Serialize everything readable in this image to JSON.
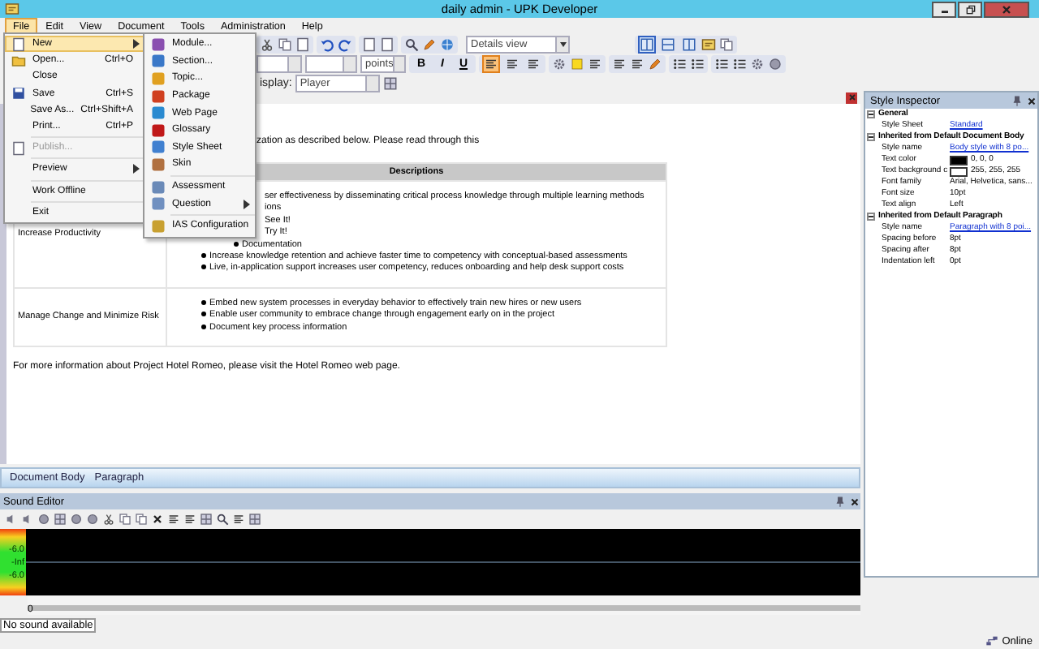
{
  "window": {
    "title": "daily admin - UPK Developer"
  },
  "menu_bar": [
    {
      "label": "File",
      "selected": true
    },
    {
      "label": "Edit",
      "selected": false
    },
    {
      "label": "View",
      "selected": false
    },
    {
      "label": "Document",
      "selected": false
    },
    {
      "label": "Tools",
      "selected": false
    },
    {
      "label": "Administration",
      "selected": false
    },
    {
      "label": "Help",
      "selected": false
    }
  ],
  "file_menu": [
    {
      "kind": "item",
      "label": "New",
      "submenu": true,
      "selected": true,
      "disabled": false
    },
    {
      "kind": "item",
      "label": "Open...",
      "shortcut": "Ctrl+O",
      "submenu": false,
      "selected": false,
      "disabled": false
    },
    {
      "kind": "item",
      "label": "Close",
      "submenu": false,
      "selected": false,
      "disabled": false
    },
    {
      "kind": "item",
      "label": "Save",
      "shortcut": "Ctrl+S",
      "submenu": false,
      "selected": false,
      "disabled": false
    },
    {
      "kind": "item",
      "label": "Save As...",
      "shortcut": "Ctrl+Shift+A",
      "submenu": false,
      "selected": false,
      "disabled": false
    },
    {
      "kind": "item",
      "label": "Print...",
      "shortcut": "Ctrl+P",
      "submenu": false,
      "selected": false,
      "disabled": false
    },
    {
      "kind": "separator"
    },
    {
      "kind": "item",
      "label": "Publish...",
      "submenu": false,
      "selected": false,
      "disabled": true
    },
    {
      "kind": "separator"
    },
    {
      "kind": "item",
      "label": "Preview",
      "submenu": true,
      "selected": false,
      "disabled": false
    },
    {
      "kind": "separator"
    },
    {
      "kind": "item",
      "label": "Work Offline",
      "submenu": false,
      "selected": false,
      "disabled": false
    },
    {
      "kind": "separator"
    },
    {
      "kind": "item",
      "label": "Exit",
      "submenu": false,
      "selected": false,
      "disabled": false
    }
  ],
  "new_submenu": [
    {
      "kind": "item",
      "label": "Module...",
      "submenu": false,
      "color": "#8a4fb0"
    },
    {
      "kind": "item",
      "label": "Section...",
      "submenu": false,
      "color": "#3a78c8"
    },
    {
      "kind": "item",
      "label": "Topic...",
      "submenu": false,
      "color": "#e0a020"
    },
    {
      "kind": "item",
      "label": "Package",
      "submenu": false,
      "color": "#d04020"
    },
    {
      "kind": "item",
      "label": "Web Page",
      "submenu": false,
      "color": "#2a8ad0"
    },
    {
      "kind": "item",
      "label": "Glossary",
      "submenu": false,
      "color": "#c01818"
    },
    {
      "kind": "item",
      "label": "Style Sheet",
      "submenu": false,
      "color": "#4080d0"
    },
    {
      "kind": "item",
      "label": "Skin",
      "submenu": false,
      "color": "#b07040"
    },
    {
      "kind": "separator"
    },
    {
      "kind": "item",
      "label": "Assessment",
      "submenu": false,
      "color": "#6a8ab8"
    },
    {
      "kind": "item",
      "label": "Question",
      "submenu": true,
      "color": "#7090c0"
    },
    {
      "kind": "separator"
    },
    {
      "kind": "item",
      "label": "IAS Configuration",
      "submenu": false,
      "color": "#c8a030"
    }
  ],
  "toolbar": {
    "view_select": "Details view",
    "layout_buttons": [
      {
        "selected": true
      },
      {
        "selected": false
      },
      {
        "selected": false
      }
    ],
    "size_select": "points",
    "format_buttons": [
      {
        "label": "B",
        "selected": false
      },
      {
        "label": "I",
        "selected": false
      },
      {
        "label": "U",
        "selected": false
      }
    ],
    "align_buttons": [
      {
        "selected": true
      },
      {
        "selected": false
      },
      {
        "selected": false
      }
    ],
    "display_label": "isplay:",
    "display_select": "Player"
  },
  "document": {
    "intro": "zation as described below. Please read through this",
    "table": {
      "header": "Descriptions",
      "rows": [
        {
          "label": "Increase Productivity",
          "items": [
            {
              "text": "ser effectiveness by disseminating critical process knowledge through multiple learning methods",
              "covered": true,
              "children": [
                {
                  "text": "ions",
                  "covered": true,
                  "children": [
                    {
                      "text": "See It!",
                      "covered": true
                    },
                    {
                      "text": "Try It!",
                      "covered": true
                    },
                    {
                      "text": "Documentation",
                      "covered": false
                    }
                  ]
                }
              ]
            },
            {
              "text": "Increase knowledge retention and achieve faster time to competency with conceptual-based assessments",
              "covered": false
            },
            {
              "text": "Live, in-application support increases user competency, reduces onboarding and help desk support costs",
              "covered": false
            }
          ]
        },
        {
          "label": "Manage Change and Minimize Risk",
          "items": [
            {
              "text": "Embed new system processes in everyday behavior to effectively train new hires or new users",
              "covered": false
            },
            {
              "text": "Enable user community to embrace change through engagement early on in the project",
              "covered": false
            },
            {
              "text": "Document key process information",
              "covered": false
            }
          ]
        }
      ]
    },
    "footer": "For more information about Project Hotel Romeo, please visit the Hotel Romeo web page."
  },
  "breadcrumb": [
    "Document Body",
    "Paragraph"
  ],
  "sound_editor": {
    "title": "Sound Editor",
    "meter_labels": [
      "-6.0",
      "-Inf",
      "-6.0"
    ],
    "ruler_label": "0",
    "status": "No sound available"
  },
  "style_inspector": {
    "title": "Style Inspector",
    "sections": [
      {
        "title": "General",
        "expanded": true,
        "rows": [
          {
            "kind": "link",
            "label": "Style Sheet",
            "value": "Standard"
          }
        ]
      },
      {
        "title": "Inherited from Default Document Body",
        "expanded": true,
        "rows": [
          {
            "kind": "link",
            "label": "Style name",
            "value": "Body style with 8 po..."
          },
          {
            "kind": "color",
            "label": "Text color",
            "value": "0, 0, 0",
            "color": "#000000"
          },
          {
            "kind": "color",
            "label": "Text background c",
            "value": "255, 255, 255",
            "color": "#ffffff"
          },
          {
            "kind": "text",
            "label": "Font family",
            "value": "Arial, Helvetica, sans..."
          },
          {
            "kind": "text",
            "label": "Font size",
            "value": "10pt"
          },
          {
            "kind": "text",
            "label": "Text align",
            "value": "Left"
          }
        ]
      },
      {
        "title": "Inherited from Default Paragraph",
        "expanded": true,
        "rows": [
          {
            "kind": "link",
            "label": "Style name",
            "value": "Paragraph with 8 poi..."
          },
          {
            "kind": "text",
            "label": "Spacing before",
            "value": "8pt"
          },
          {
            "kind": "text",
            "label": "Spacing after",
            "value": "8pt"
          },
          {
            "kind": "text",
            "label": "Indentation left",
            "value": "0pt"
          }
        ]
      }
    ]
  },
  "status_bar": {
    "text": "Online"
  }
}
